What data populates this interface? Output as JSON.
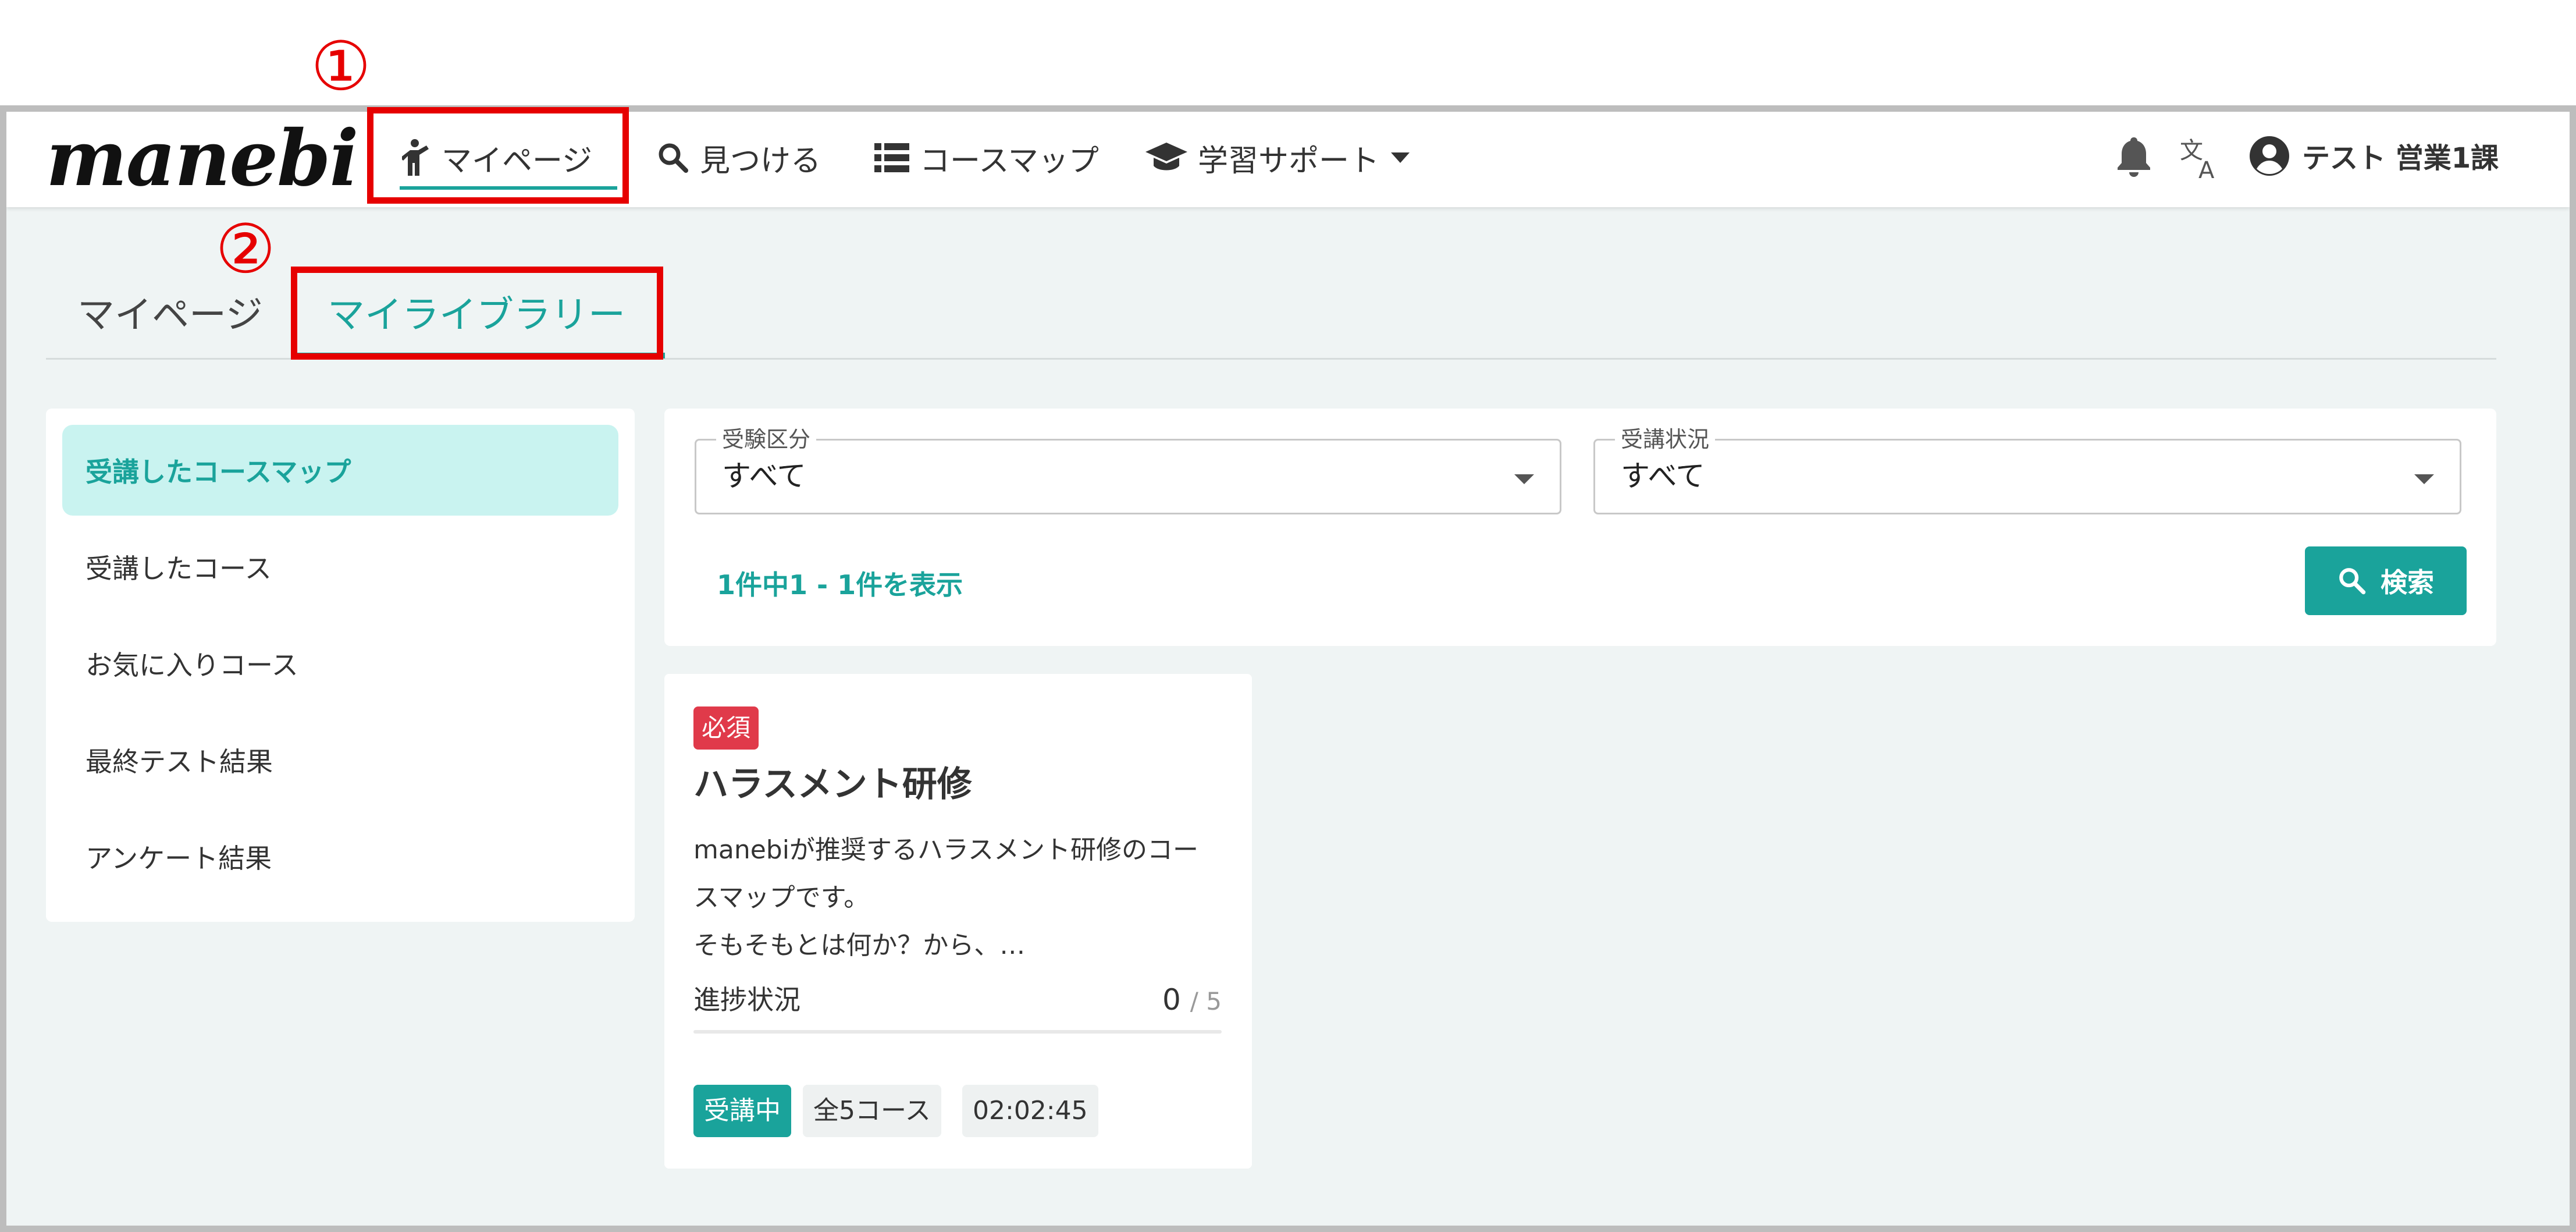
{
  "header": {
    "logo": "manebi",
    "nav": [
      {
        "label": "マイページ",
        "icon": "person-icon"
      },
      {
        "label": "見つける",
        "icon": "search-icon"
      },
      {
        "label": "コースマップ",
        "icon": "list-icon"
      },
      {
        "label": "学習サポート",
        "icon": "graduation-cap-icon"
      }
    ],
    "icons": [
      "bell-icon",
      "translate-icon",
      "account-circle-icon"
    ],
    "user_name": "テスト 営業1課"
  },
  "tabs": [
    {
      "label": "マイページ",
      "active": false
    },
    {
      "label": "マイライブラリー",
      "active": true
    }
  ],
  "sidebar": {
    "items": [
      {
        "label": "受講したコースマップ",
        "active": true
      },
      {
        "label": "受講したコース",
        "active": false
      },
      {
        "label": "お気に入りコース",
        "active": false
      },
      {
        "label": "最終テスト結果",
        "active": false
      },
      {
        "label": "アンケート結果",
        "active": false
      }
    ]
  },
  "filters": {
    "exam_category": {
      "label": "受験区分",
      "value": "すべて"
    },
    "attendance_status": {
      "label": "受講状況",
      "value": "すべて"
    },
    "results_text": "1件中1 - 1件を表示",
    "search_label": "検索"
  },
  "card": {
    "badge": "必須",
    "title": "ハラスメント研修",
    "description_lines": [
      "manebiが推奨するハラスメント研修のコー",
      "スマップです。",
      "そもそもとは何か？から、…"
    ],
    "progress_label": "進捗状況",
    "progress_done": "0",
    "progress_total": "/ 5",
    "progress_fraction": 0,
    "status": "受講中",
    "courses": "全5コース",
    "duration": "02:02:45"
  },
  "annotations": {
    "one": "①",
    "two": "②"
  },
  "colors": {
    "accent": "#1aa39b",
    "required": "#e03a4a",
    "annotation": "#e60000"
  }
}
